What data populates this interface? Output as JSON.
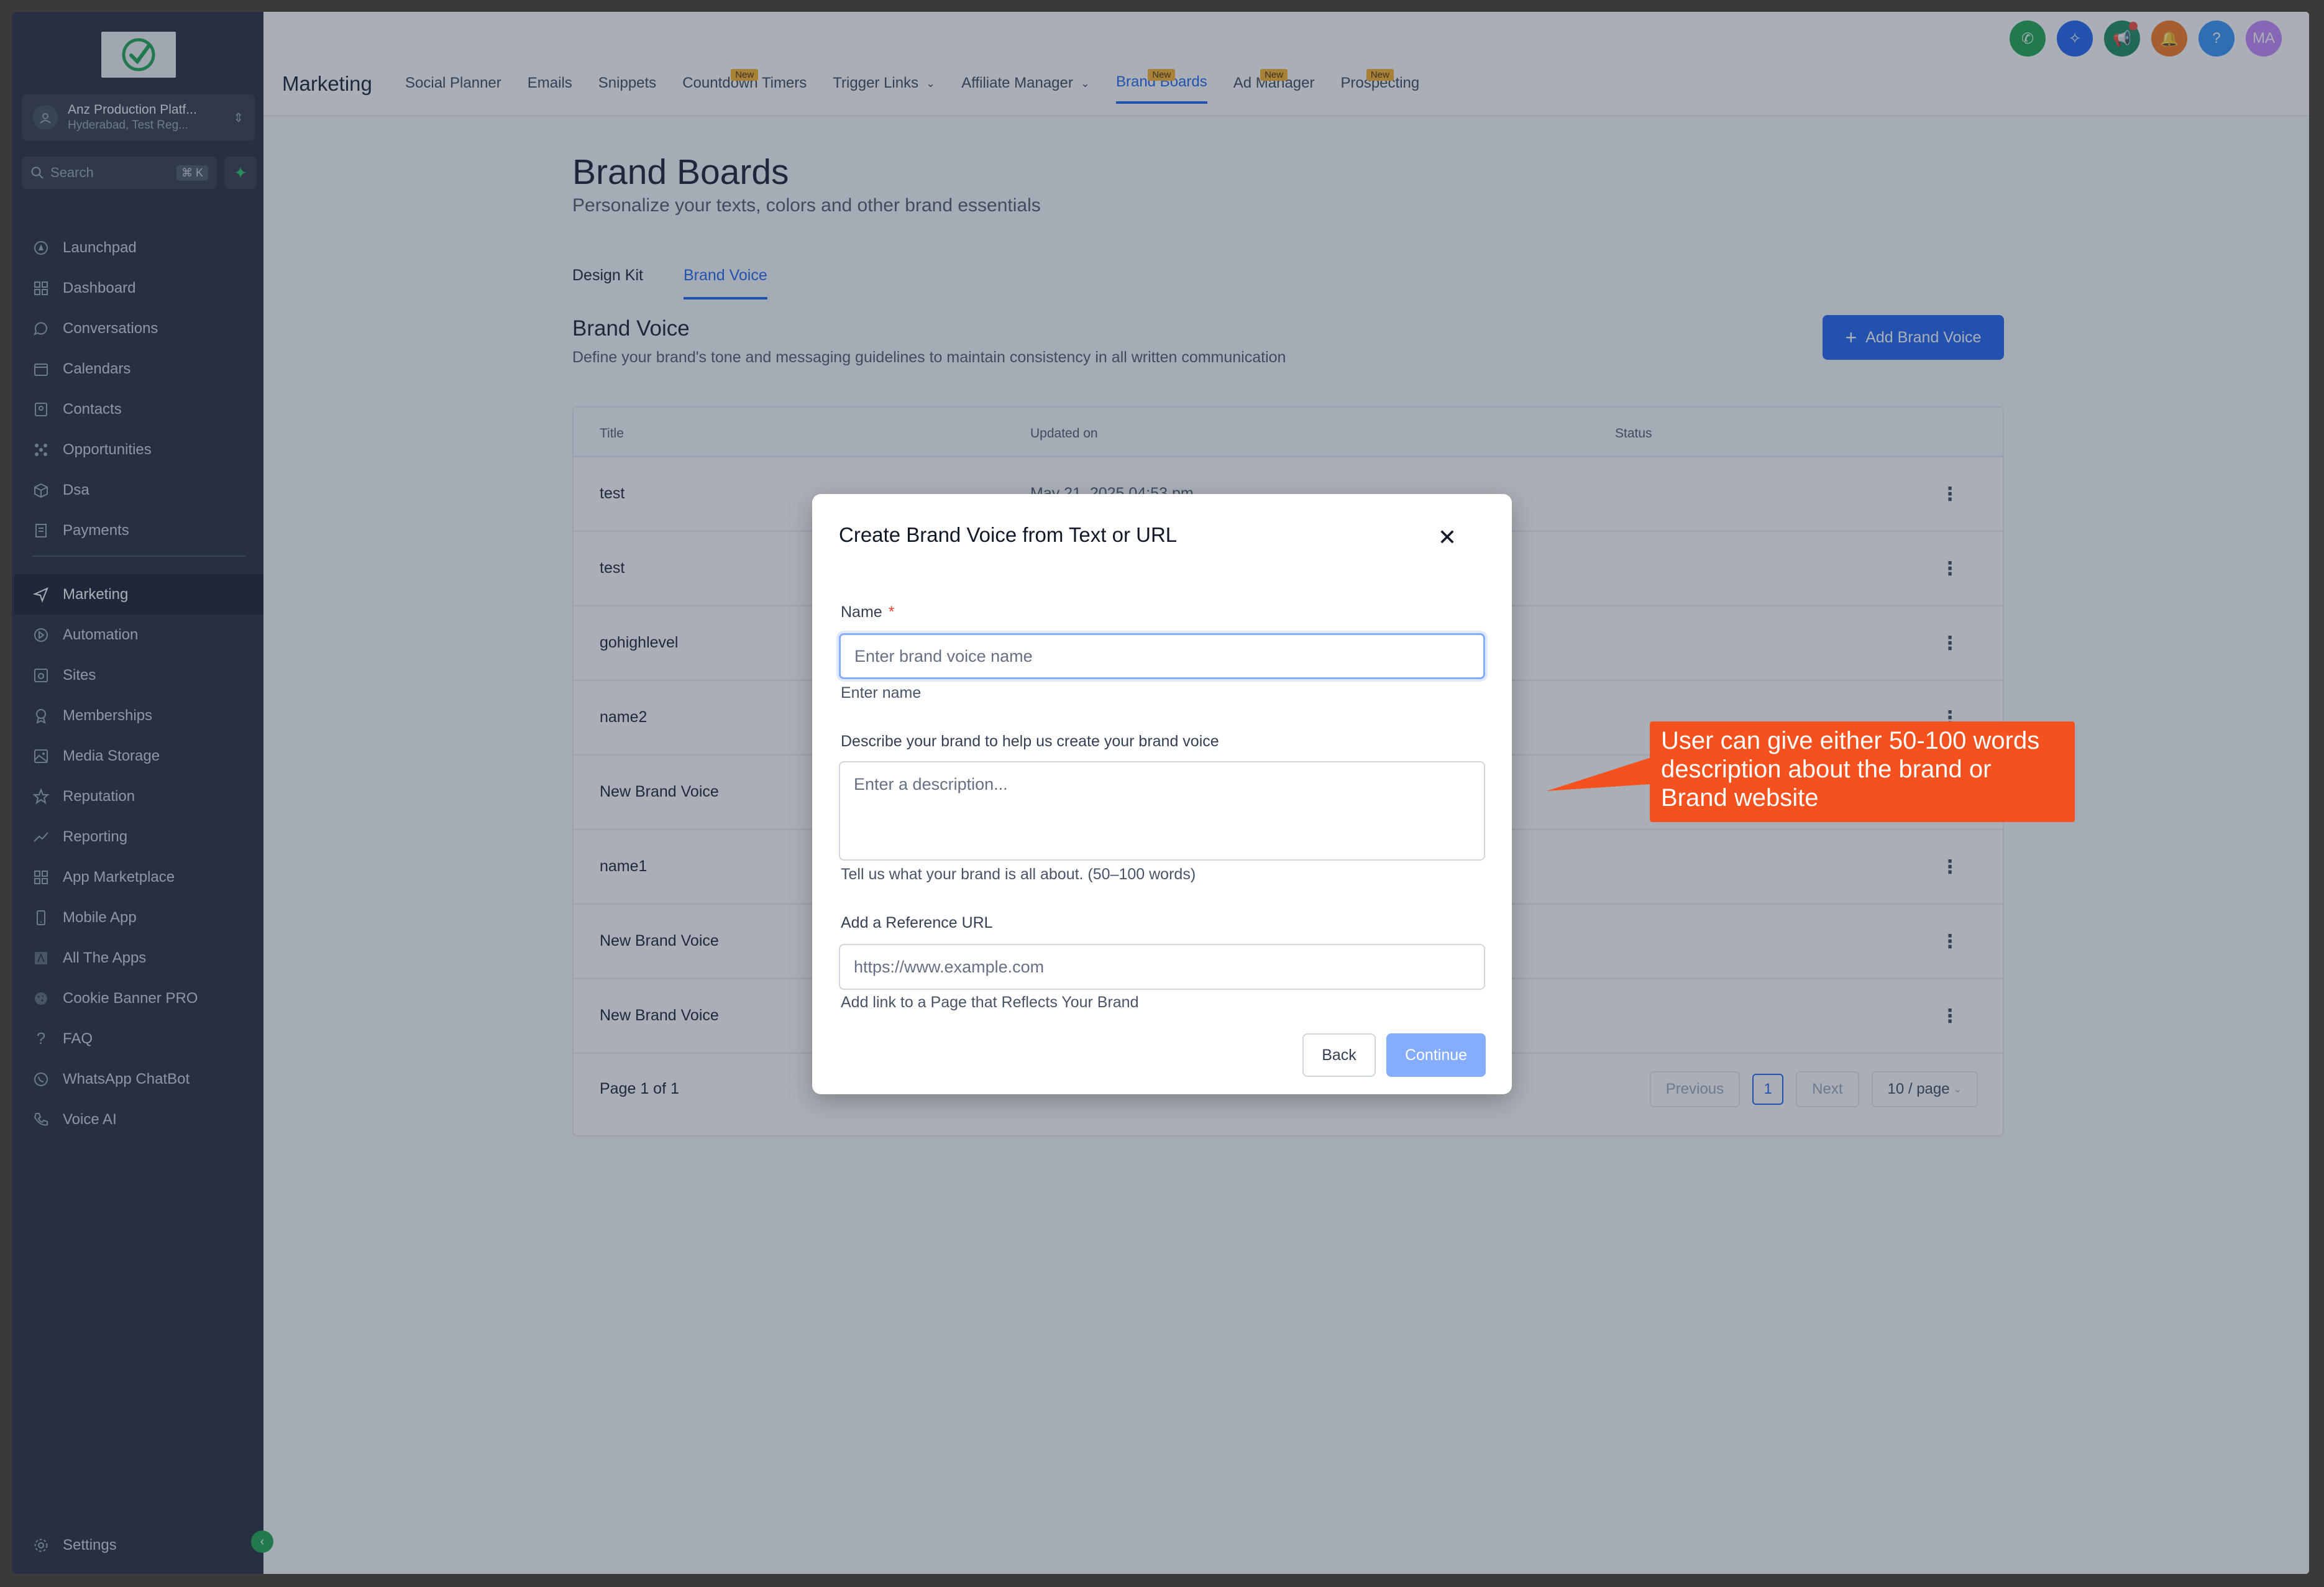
{
  "sidebar": {
    "account_name": "Anz Production Platf...",
    "account_sub": "Hyderabad, Test Reg...",
    "search_placeholder": "Search",
    "search_shortcut": "⌘ K",
    "items_top": [
      {
        "label": "Launchpad",
        "icon": "rocket-icon"
      },
      {
        "label": "Dashboard",
        "icon": "grid-icon"
      },
      {
        "label": "Conversations",
        "icon": "chat-icon"
      },
      {
        "label": "Calendars",
        "icon": "calendar-icon"
      },
      {
        "label": "Contacts",
        "icon": "contacts-icon"
      },
      {
        "label": "Opportunities",
        "icon": "network-icon"
      },
      {
        "label": "Dsa",
        "icon": "box-icon"
      },
      {
        "label": "Payments",
        "icon": "receipt-icon"
      }
    ],
    "items_bottom": [
      {
        "label": "Marketing",
        "icon": "send-icon"
      },
      {
        "label": "Automation",
        "icon": "automation-icon"
      },
      {
        "label": "Sites",
        "icon": "sites-icon"
      },
      {
        "label": "Memberships",
        "icon": "award-icon"
      },
      {
        "label": "Media Storage",
        "icon": "image-icon"
      },
      {
        "label": "Reputation",
        "icon": "star-icon"
      },
      {
        "label": "Reporting",
        "icon": "trend-icon"
      },
      {
        "label": "App Marketplace",
        "icon": "apps-icon"
      },
      {
        "label": "Mobile App",
        "icon": "mobile-icon"
      },
      {
        "label": "All The Apps",
        "icon": "allapps-icon"
      },
      {
        "label": "Cookie Banner PRO",
        "icon": "cookie-icon"
      },
      {
        "label": "FAQ",
        "icon": "question-icon"
      },
      {
        "label": "WhatsApp ChatBot",
        "icon": "whatsapp-icon"
      },
      {
        "label": "Voice AI",
        "icon": "phone-icon"
      }
    ],
    "settings_label": "Settings"
  },
  "topbar": {
    "title": "Marketing",
    "tabs": [
      {
        "label": "Social Planner",
        "badge": ""
      },
      {
        "label": "Emails",
        "badge": ""
      },
      {
        "label": "Snippets",
        "badge": ""
      },
      {
        "label": "Countdown Timers",
        "badge": "New"
      },
      {
        "label": "Trigger Links",
        "badge": ""
      },
      {
        "label": "Affiliate Manager",
        "badge": ""
      },
      {
        "label": "Brand Boards",
        "badge": "New"
      },
      {
        "label": "Ad Manager",
        "badge": "New"
      },
      {
        "label": "Prospecting",
        "badge": "New"
      }
    ],
    "avatar_initials": "MA",
    "help_glyph": "?"
  },
  "colors": {
    "primary": "#155eef",
    "sidebar_bg": "#1d2533",
    "callout": "#f4511e"
  },
  "page": {
    "title": "Brand Boards",
    "subtitle": "Personalize your texts, colors and other brand essentials",
    "tabs": [
      "Design Kit",
      "Brand Voice"
    ],
    "section_title": "Brand Voice",
    "section_sub": "Define your brand's tone and messaging guidelines to maintain consistency in all written communication",
    "add_button": "Add Brand Voice",
    "add_button_glyph": "+"
  },
  "table": {
    "headers": [
      "Title",
      "Updated on",
      "Status"
    ],
    "rows": [
      {
        "title": "test",
        "date": "May 21, 2025 04:53 pm"
      },
      {
        "title": "test",
        "date": ""
      },
      {
        "title": "gohighlevel",
        "date": ""
      },
      {
        "title": "name2",
        "date": ""
      },
      {
        "title": "New Brand Voice",
        "date": ""
      },
      {
        "title": "name1",
        "date": ""
      },
      {
        "title": "New Brand Voice",
        "date": ""
      },
      {
        "title": "New Brand Voice",
        "date": ""
      }
    ],
    "kebab_glyph": "⋮",
    "page_info": "Page 1 of 1",
    "prev": "Previous",
    "page_num": "1",
    "next": "Next",
    "page_size": "10 / page"
  },
  "modal": {
    "title": "Create Brand Voice from Text or URL",
    "close_glyph": "✕",
    "name_label": "Name",
    "required_mark": "*",
    "name_placeholder": "Enter brand voice name",
    "name_help": "Enter name",
    "desc_label": "Describe your brand to help us create your brand voice",
    "desc_placeholder": "Enter a description...",
    "desc_help": "Tell us what your brand is all about. (50–100 words)",
    "url_label": "Add a Reference URL",
    "url_placeholder": "https://www.example.com",
    "url_help": "Add link to a Page that Reflects Your Brand",
    "back": "Back",
    "continue": "Continue"
  },
  "callout": {
    "text": "User can give either 50-100 words description about the brand or Brand website"
  }
}
